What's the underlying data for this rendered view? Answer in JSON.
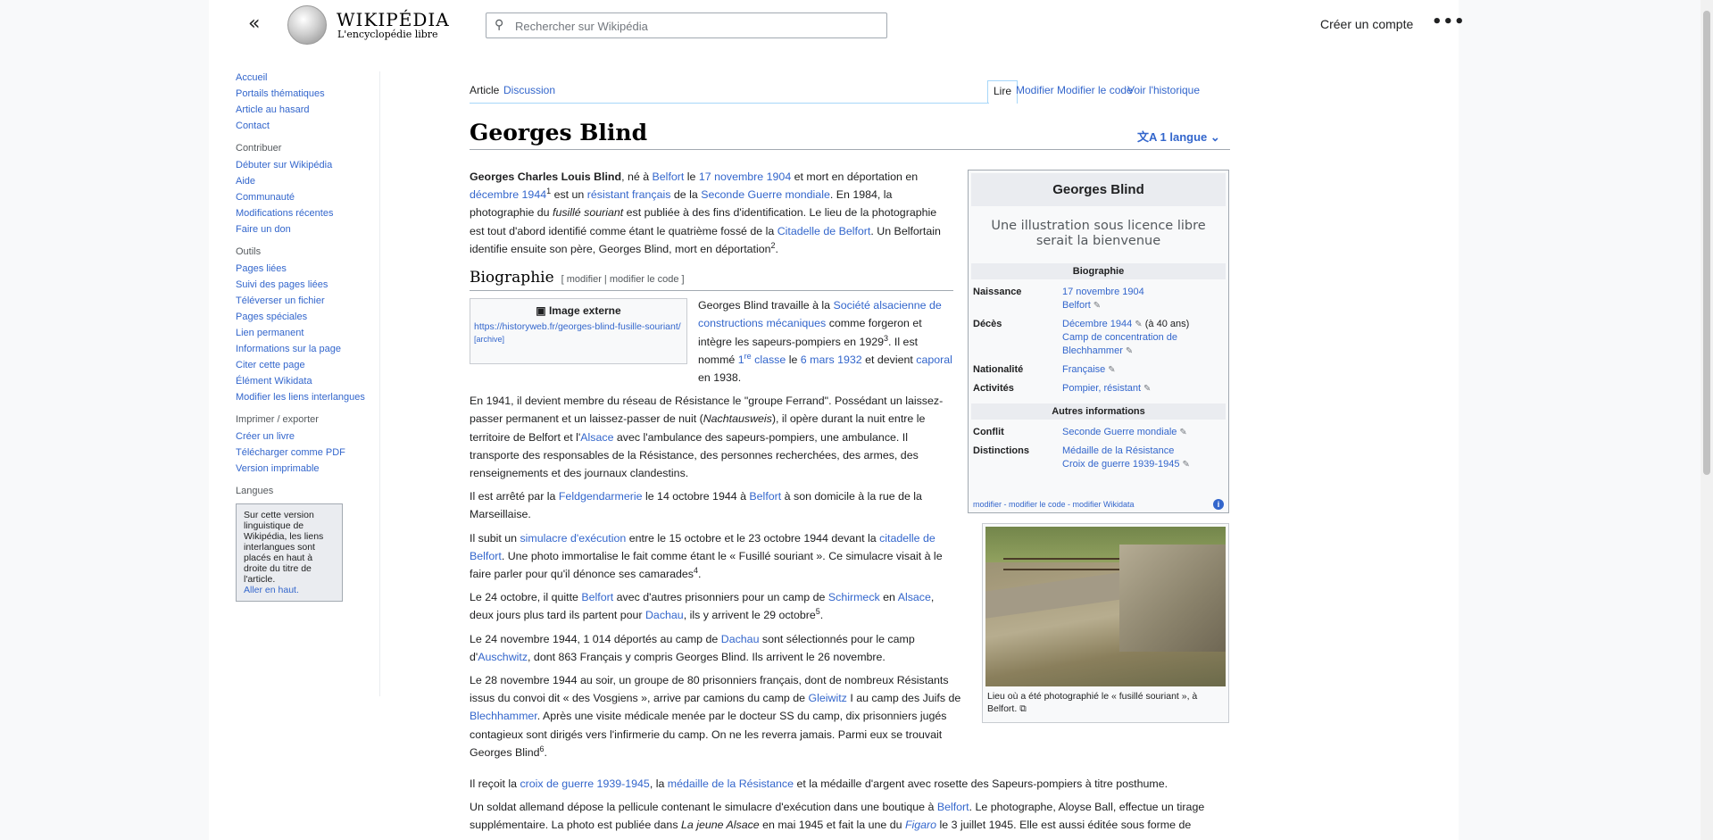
{
  "header": {
    "wordmark": "WIKIPÉDIA",
    "tagline": "L'encyclopédie libre",
    "search_placeholder": "Rechercher sur Wikipédia",
    "create_account": "Créer un compte",
    "more": "•••",
    "menu": "«"
  },
  "sidebar": {
    "main_links": [
      "Accueil",
      "Portails thématiques",
      "Article au hasard",
      "Contact"
    ],
    "contribute_heading": "Contribuer",
    "contribute_links": [
      "Débuter sur Wikipédia",
      "Aide",
      "Communauté",
      "Modifications récentes",
      "Faire un don"
    ],
    "tools_heading": "Outils",
    "tools_links": [
      "Pages liées",
      "Suivi des pages liées",
      "Téléverser un fichier",
      "Pages spéciales",
      "Lien permanent",
      "Informations sur la page",
      "Citer cette page",
      "Élément Wikidata",
      "Modifier les liens interlangues"
    ],
    "print_heading": "Imprimer / exporter",
    "print_links": [
      "Créer un livre",
      "Télécharger comme PDF",
      "Version imprimable"
    ],
    "lang_heading": "Langues",
    "lang_note": "Sur cette version linguistique de Wikipédia, les liens interlangues sont placés en haut à droite du titre de l'article.",
    "lang_top": "Aller en haut."
  },
  "tabs": {
    "article": "Article",
    "discussion": "Discussion",
    "read": "Lire",
    "edit": "Modifier",
    "edit_code": "Modifier le code",
    "history": "Voir l'historique"
  },
  "article": {
    "title": "Georges Blind",
    "languages": "1 langue",
    "section_bio": "Biographie",
    "section_edit": "[ modifier | modifier le code ]",
    "external_image_title": "Image externe",
    "external_image_url": "https://historyweb.fr/georges-blind-fusille-souriant/",
    "external_image_archive": "[archive]"
  },
  "infobox": {
    "title": "Georges Blind",
    "image_placeholder": "Une illustration sous licence libre serait la bienvenue",
    "sec_bio": "Biographie",
    "birth_label": "Naissance",
    "birth_date": "17 novembre 1904",
    "birth_place": "Belfort",
    "death_label": "Décès",
    "death_date": "Décembre 1944",
    "death_age": "(à 40 ans)",
    "death_place": "Camp de concentration de Blechhammer",
    "nationality_label": "Nationalité",
    "nationality": "Française",
    "activities_label": "Activités",
    "activities": "Pompier, résistant",
    "sec_other": "Autres informations",
    "conflict_label": "Conflit",
    "conflict": "Seconde Guerre mondiale",
    "distinctions_label": "Distinctions",
    "distinction1": "Médaille de la Résistance",
    "distinction2": "Croix de guerre 1939-1945",
    "footer": "modifier - modifier le code - modifier Wikidata"
  },
  "thumb": {
    "caption": "Lieu où a été photographié le « fusillé souriant », à Belfort."
  }
}
